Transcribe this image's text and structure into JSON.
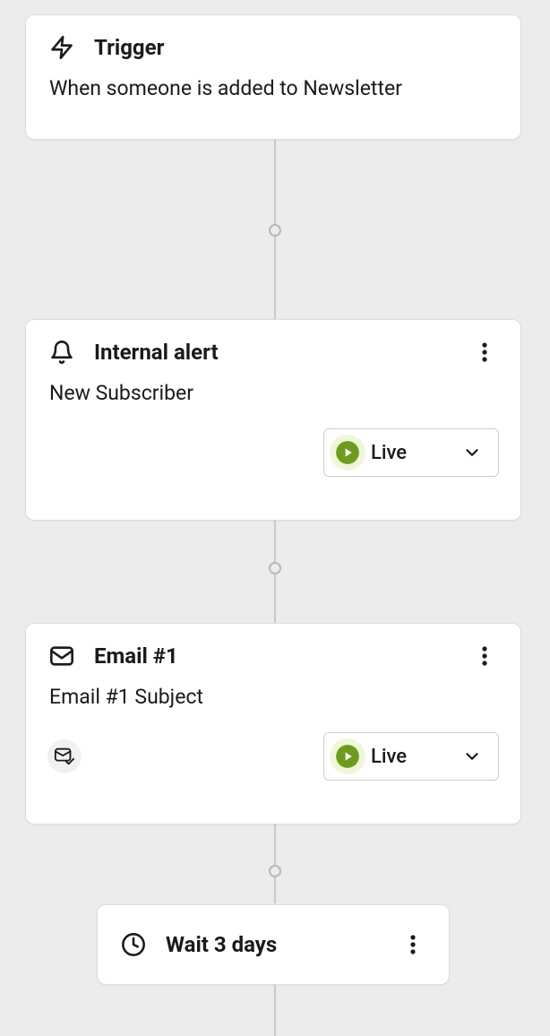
{
  "trigger": {
    "title": "Trigger",
    "description": "When someone is added to Newsletter"
  },
  "alert": {
    "title": "Internal alert",
    "description": "New Subscriber",
    "status": "Live"
  },
  "email1": {
    "title": "Email #1",
    "description": "Email #1 Subject",
    "status": "Live"
  },
  "wait": {
    "label": "Wait 3 days"
  }
}
